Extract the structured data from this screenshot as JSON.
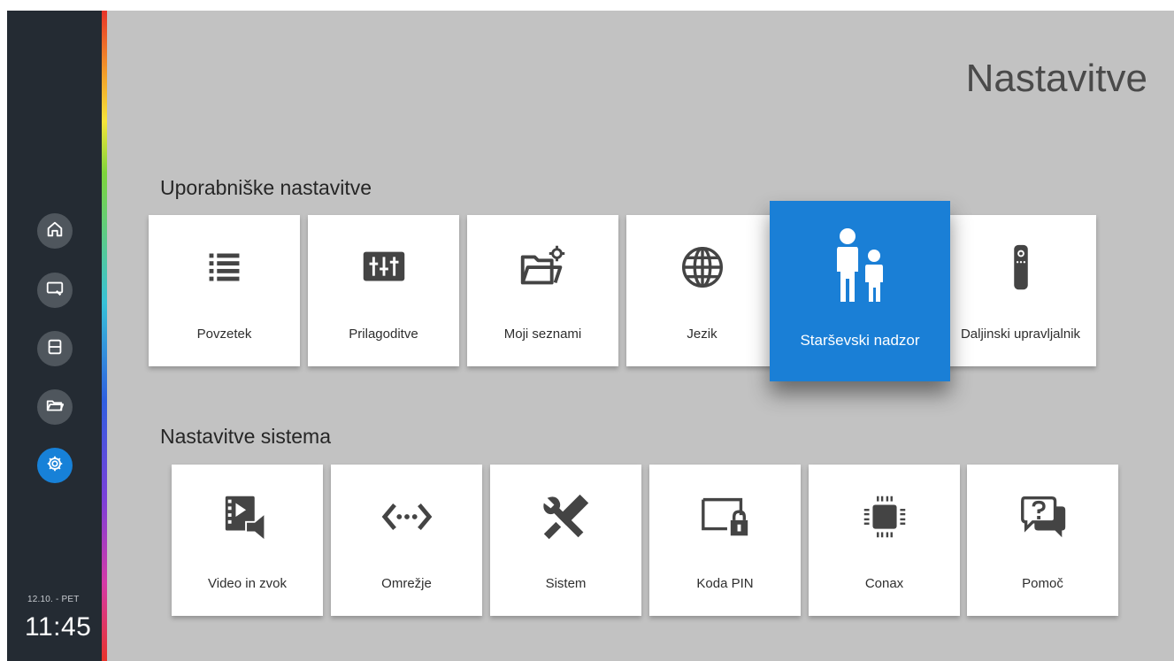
{
  "page": {
    "title": "Nastavitve"
  },
  "sidebar": {
    "items": [
      {
        "icon": "home-icon"
      },
      {
        "icon": "tv-remote-icon"
      },
      {
        "icon": "film-icon"
      },
      {
        "icon": "folder-icon"
      },
      {
        "icon": "gear-icon",
        "active": true
      }
    ],
    "date": "12.10. - PET",
    "time": "11:45",
    "accent": "#1781d8"
  },
  "sections": {
    "user": {
      "title": "Uporabniške nastavitve",
      "tiles": [
        {
          "label": "Povzetek",
          "icon": "list-icon"
        },
        {
          "label": "Prilagoditve",
          "icon": "sliders-icon"
        },
        {
          "label": "Moji seznami",
          "icon": "folder-gear-icon"
        },
        {
          "label": "Jezik",
          "icon": "globe-icon"
        },
        {
          "label": "Starševski nadzor",
          "icon": "parent-child-icon",
          "focused": true
        },
        {
          "label": "Daljinski upravljalnik",
          "icon": "remote-control-icon"
        }
      ]
    },
    "system": {
      "title": "Nastavitve sistema",
      "tiles": [
        {
          "label": "Video in zvok",
          "icon": "video-audio-icon"
        },
        {
          "label": "Omrežje",
          "icon": "network-icon"
        },
        {
          "label": "Sistem",
          "icon": "tools-icon"
        },
        {
          "label": "Koda PIN",
          "icon": "screen-lock-icon"
        },
        {
          "label": "Conax",
          "icon": "chip-icon"
        },
        {
          "label": "Pomoč",
          "icon": "help-chat-icon"
        }
      ]
    }
  },
  "colors": {
    "focus": "#1a7fd6",
    "background": "#c2c2c2",
    "sidebar": "#242b33"
  }
}
